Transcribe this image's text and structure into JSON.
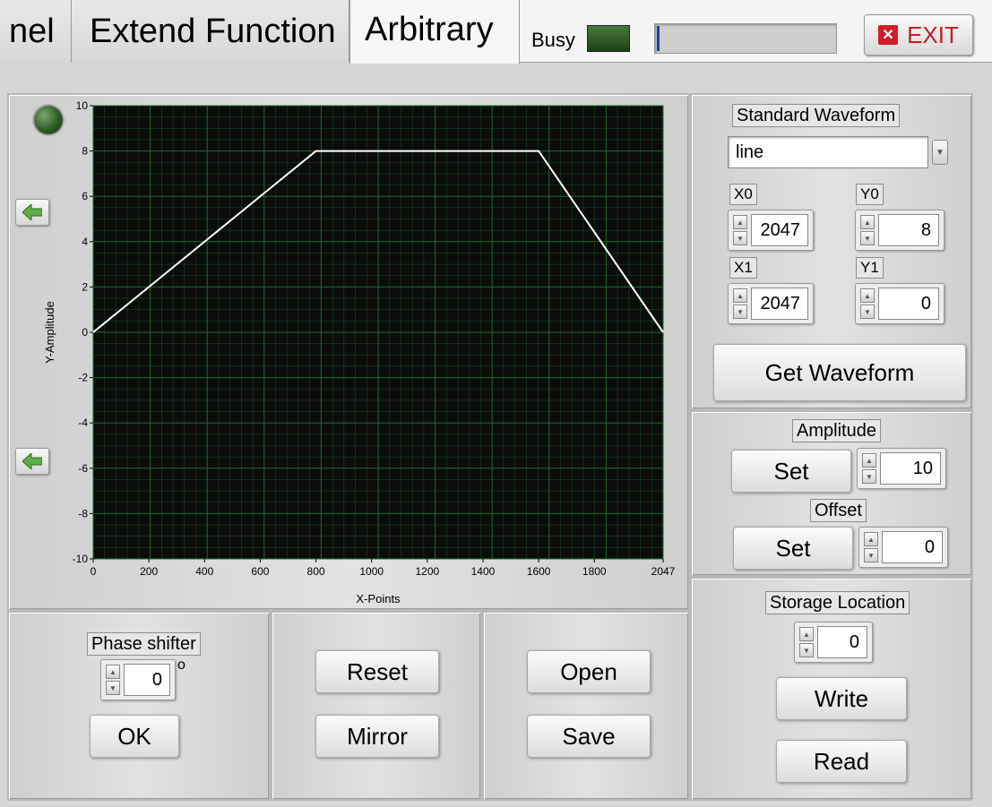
{
  "tabs": [
    {
      "label": "nel",
      "active": false
    },
    {
      "label": "Extend Function",
      "active": false
    },
    {
      "label": "Arbitrary",
      "active": true
    }
  ],
  "status": {
    "busy_label": "Busy",
    "progress_fraction": 0.01
  },
  "exit_label": "EXIT",
  "graph": {
    "y_label": "Y-Amplitude",
    "x_label": "X-Points",
    "y_ticks": [
      "10",
      "8",
      "6",
      "4",
      "2",
      "0",
      "-2",
      "-4",
      "-6",
      "-8",
      "-10"
    ],
    "x_ticks": [
      "0",
      "200",
      "400",
      "600",
      "800",
      "1000",
      "1200",
      "1400",
      "1600",
      "1800",
      "2047"
    ]
  },
  "chart_data": {
    "type": "line",
    "xlabel": "X-Points",
    "ylabel": "Y-Amplitude",
    "xlim": [
      0,
      2047
    ],
    "ylim": [
      -10,
      10
    ],
    "grid": true,
    "x": [
      0,
      800,
      1600,
      2047
    ],
    "y": [
      0,
      8,
      8,
      0
    ]
  },
  "colors": {
    "plot_bg": "#0c0c0c",
    "grid": "#1f6b2a",
    "trace": "#ffffff"
  },
  "standard_waveform": {
    "label": "Standard Waveform",
    "selected": "line",
    "x0_label": "X0",
    "x0": "2047",
    "y0_label": "Y0",
    "y0": "8",
    "x1_label": "X1",
    "x1": "2047",
    "y1_label": "Y1",
    "y1": "0",
    "get_button": "Get Waveform"
  },
  "amplitude": {
    "label": "Amplitude",
    "set_button": "Set",
    "value": "10"
  },
  "offset": {
    "label": "Offset",
    "set_button": "Set",
    "value": "0"
  },
  "storage": {
    "label": "Storage Location",
    "value": "0",
    "write_button": "Write",
    "read_button": "Read"
  },
  "phase": {
    "label": "Phase shifter",
    "value": "0",
    "unit": "o",
    "ok_button": "OK"
  },
  "buttons": {
    "reset": "Reset",
    "mirror": "Mirror",
    "open": "Open",
    "save": "Save"
  }
}
